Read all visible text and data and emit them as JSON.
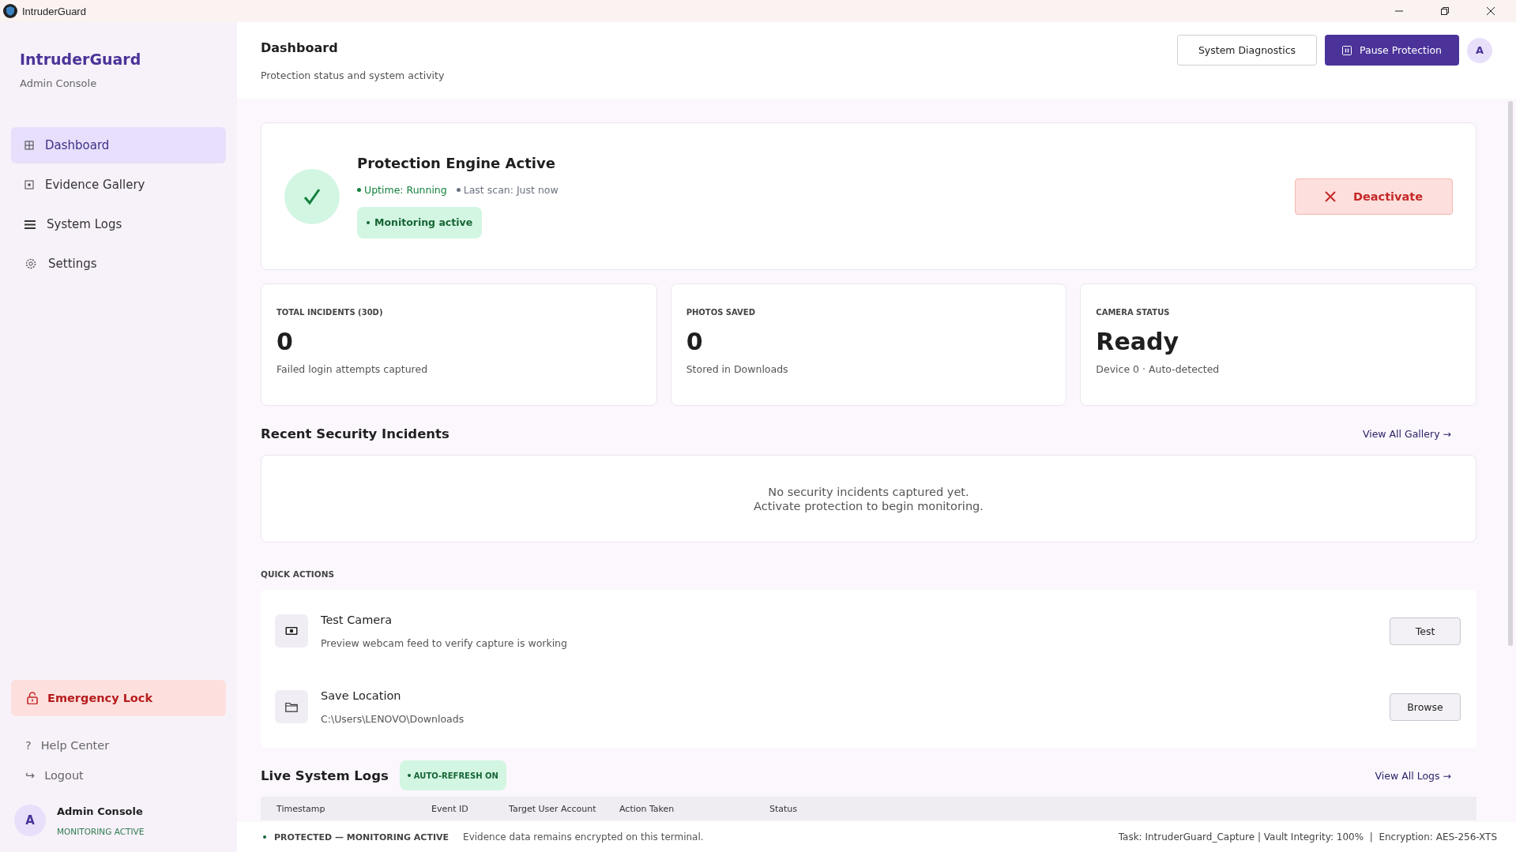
{
  "window": {
    "title": "IntruderGuard"
  },
  "sidebar": {
    "brand": "IntruderGuard",
    "subtitle": "Admin Console",
    "nav": [
      {
        "label": "Dashboard",
        "kind": "grid",
        "selected": true
      },
      {
        "label": "Evidence Gallery",
        "kind": "square",
        "selected": false
      },
      {
        "label": "System Logs",
        "kind": "list",
        "selected": false
      },
      {
        "label": "Settings",
        "kind": "gear",
        "selected": false
      }
    ],
    "emergency": "Emergency Lock",
    "links": [
      {
        "glyph": "?",
        "label": "Help Center"
      },
      {
        "glyph": "↪",
        "label": "Logout"
      }
    ],
    "user": {
      "avatar": "A",
      "name": "Admin Console",
      "status": "MONITORING ACTIVE"
    }
  },
  "header": {
    "title": "Dashboard",
    "subtitle": "Protection status and system activity",
    "secondary_button": "System Diagnostics",
    "primary_button": "Pause Protection",
    "avatar": "A"
  },
  "protection": {
    "title": "Protection Engine Active",
    "meta": [
      {
        "text": "Uptime: Running",
        "color": "#15803d"
      },
      {
        "text": "Last scan: Just now",
        "color": "#6b7280"
      }
    ],
    "badge": "Monitoring active",
    "action": "Deactivate"
  },
  "stats": [
    {
      "label": "TOTAL INCIDENTS (30D)",
      "value": "0",
      "note": "Failed login attempts captured"
    },
    {
      "label": "PHOTOS SAVED",
      "value": "0",
      "note": "Stored in Downloads"
    },
    {
      "label": "CAMERA STATUS",
      "value": "Ready",
      "note": "Device 0 · Auto-detected"
    }
  ],
  "incidents": {
    "title": "Recent Security Incidents",
    "link": "View All Gallery →",
    "empty": [
      "No security incidents captured yet.",
      "Activate protection to begin monitoring."
    ]
  },
  "quick_actions": {
    "title": "QUICK ACTIONS",
    "items": [
      {
        "kind": "camera",
        "title": "Test Camera",
        "desc": "Preview webcam feed to verify capture is working",
        "button": "Test"
      },
      {
        "kind": "folder",
        "title": "Save Location",
        "desc": "C:\\Users\\LENOVO\\Downloads",
        "button": "Browse"
      }
    ]
  },
  "logs": {
    "title": "Live System Logs",
    "badge": "AUTO-REFRESH ON",
    "link": "View All Logs →",
    "columns": [
      "Timestamp",
      "Event ID",
      "Target User Account",
      "Action Taken",
      "Status"
    ]
  },
  "status_bar": {
    "state": "PROTECTED — MONITORING ACTIVE",
    "message": "Evidence data remains encrypted on this terminal.",
    "info": "Task: IntruderGuard_Capture | Vault Integrity: 100%  |  Encryption: AES-256-XTS"
  }
}
